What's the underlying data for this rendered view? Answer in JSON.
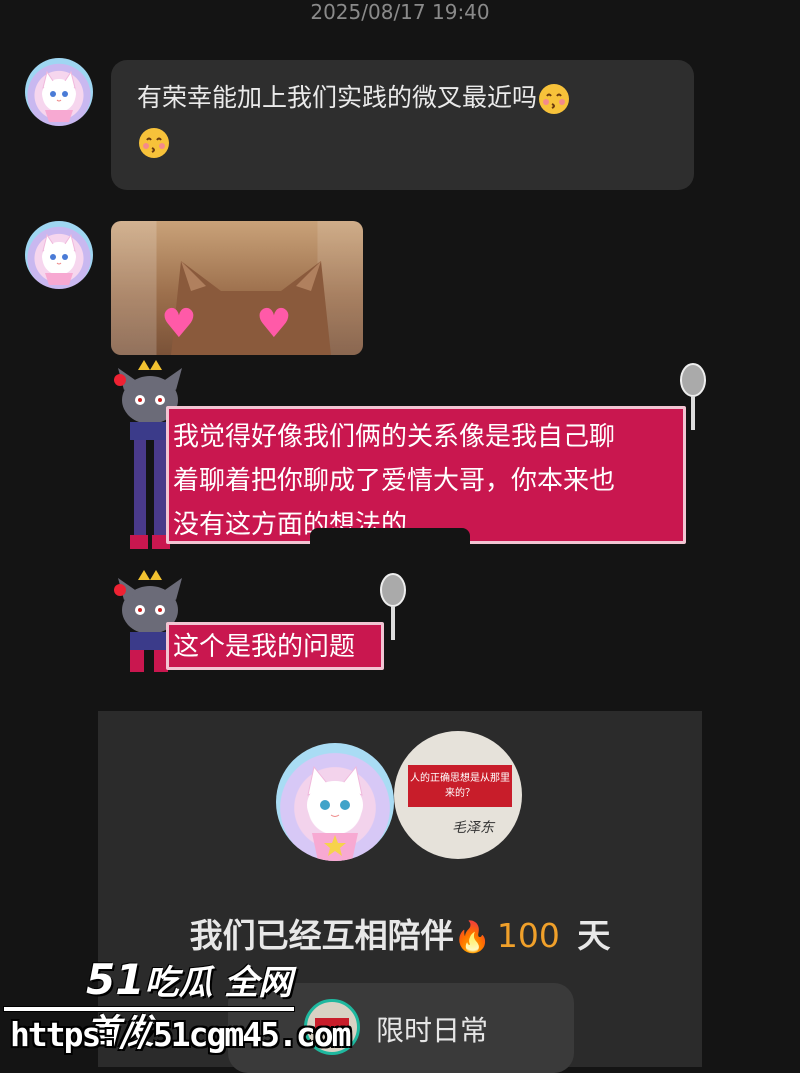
{
  "timestamp": "2025/08/17 19:40",
  "messages": {
    "m1_text": "有荣幸能加上我们实践的微叉最近吗",
    "m3_line1": "我觉得好像我们俩的关系像是我自己聊",
    "m3_line2": "着聊着把你聊成了爱情大哥，你本来也",
    "m3_line3": "没有这方面的想法的",
    "m4_text": "这个是我的问题"
  },
  "card": {
    "companion_prefix": "我们已经互相陪伴",
    "companion_days": "100",
    "companion_unit": "天",
    "note_text": "人的正确思想是从那里来的？",
    "note_sign": "毛泽东",
    "pill_label": "限时日常"
  },
  "watermark": {
    "brand_num": "51",
    "brand_text": "吃瓜 全网首发",
    "url": "https://51cgm45.com"
  },
  "colors": {
    "background": "#141414",
    "grey_bubble": "#2e2e2e",
    "pink_bubble": "#c9174f",
    "accent_orange": "#f0a02a"
  },
  "icons": [
    "cat-avatar-icon",
    "kissing-emoji-icon",
    "heart-icon",
    "fire-icon",
    "note-avatar-icon"
  ]
}
